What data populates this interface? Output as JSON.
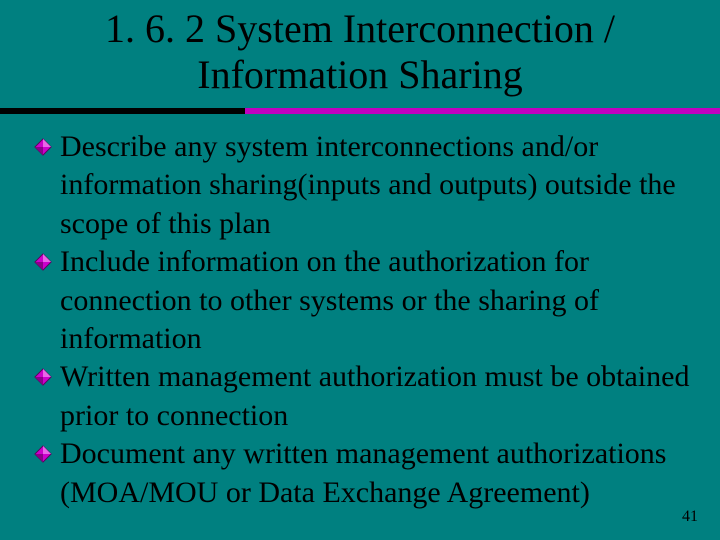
{
  "title_line1": "1. 6. 2  System Interconnection /",
  "title_line2": "Information Sharing",
  "bullets": [
    {
      "lead": "Describe",
      "rest": " any system interconnections and/or information sharing(inputs and outputs) outside the scope of this plan"
    },
    {
      "lead": "Include",
      "rest": " information on the authorization for connection to other systems or the sharing of information"
    },
    {
      "lead": "Written",
      "rest": " management authorization must be obtained prior to connection"
    },
    {
      "lead": "Document",
      "rest": " any written management authorizations (MOA/MOU or Data Exchange Agreement)"
    }
  ],
  "page_number": "41",
  "colors": {
    "background": "#008080",
    "rule_accent": "#c000c0",
    "bullet_fill": "#cc00cc",
    "bullet_edge": "#5a005a"
  }
}
